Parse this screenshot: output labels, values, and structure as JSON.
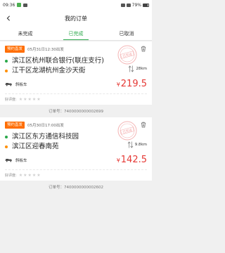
{
  "status": {
    "time": "09:36",
    "battery": "79%"
  },
  "nav": {
    "title": "我的订单"
  },
  "tabs": [
    {
      "label": "未完成"
    },
    {
      "label": "已完成"
    },
    {
      "label": "已取消"
    }
  ],
  "orders": [
    {
      "badge": "预约直发",
      "time": "05月31日12:30出发",
      "from": "滨江区杭州联合银行(联庄支行)",
      "to": "江干区龙湖杭州金沙天街",
      "distance": "28km",
      "vehicle": "斜板车",
      "price_symbol": "¥",
      "price": "219.5",
      "rating_label": "好评度:",
      "stars": 5,
      "order_no": "订单号：7400000000002699",
      "stamp": "已完成"
    },
    {
      "badge": "预约直发",
      "time": "05月30日17:00出发",
      "from": "滨江区东方通信科技园",
      "to": "滨江区迎春南苑",
      "distance": "9.8km",
      "vehicle": "斜板车",
      "price_symbol": "¥",
      "price": "142.5",
      "rating_label": "好评度:",
      "stars": 5,
      "order_no": "订单号：7400000000002602",
      "stamp": "已完成"
    }
  ],
  "colors": {
    "accent": "#2aa84a",
    "badge": "#ff6d00",
    "price": "#e53935"
  }
}
